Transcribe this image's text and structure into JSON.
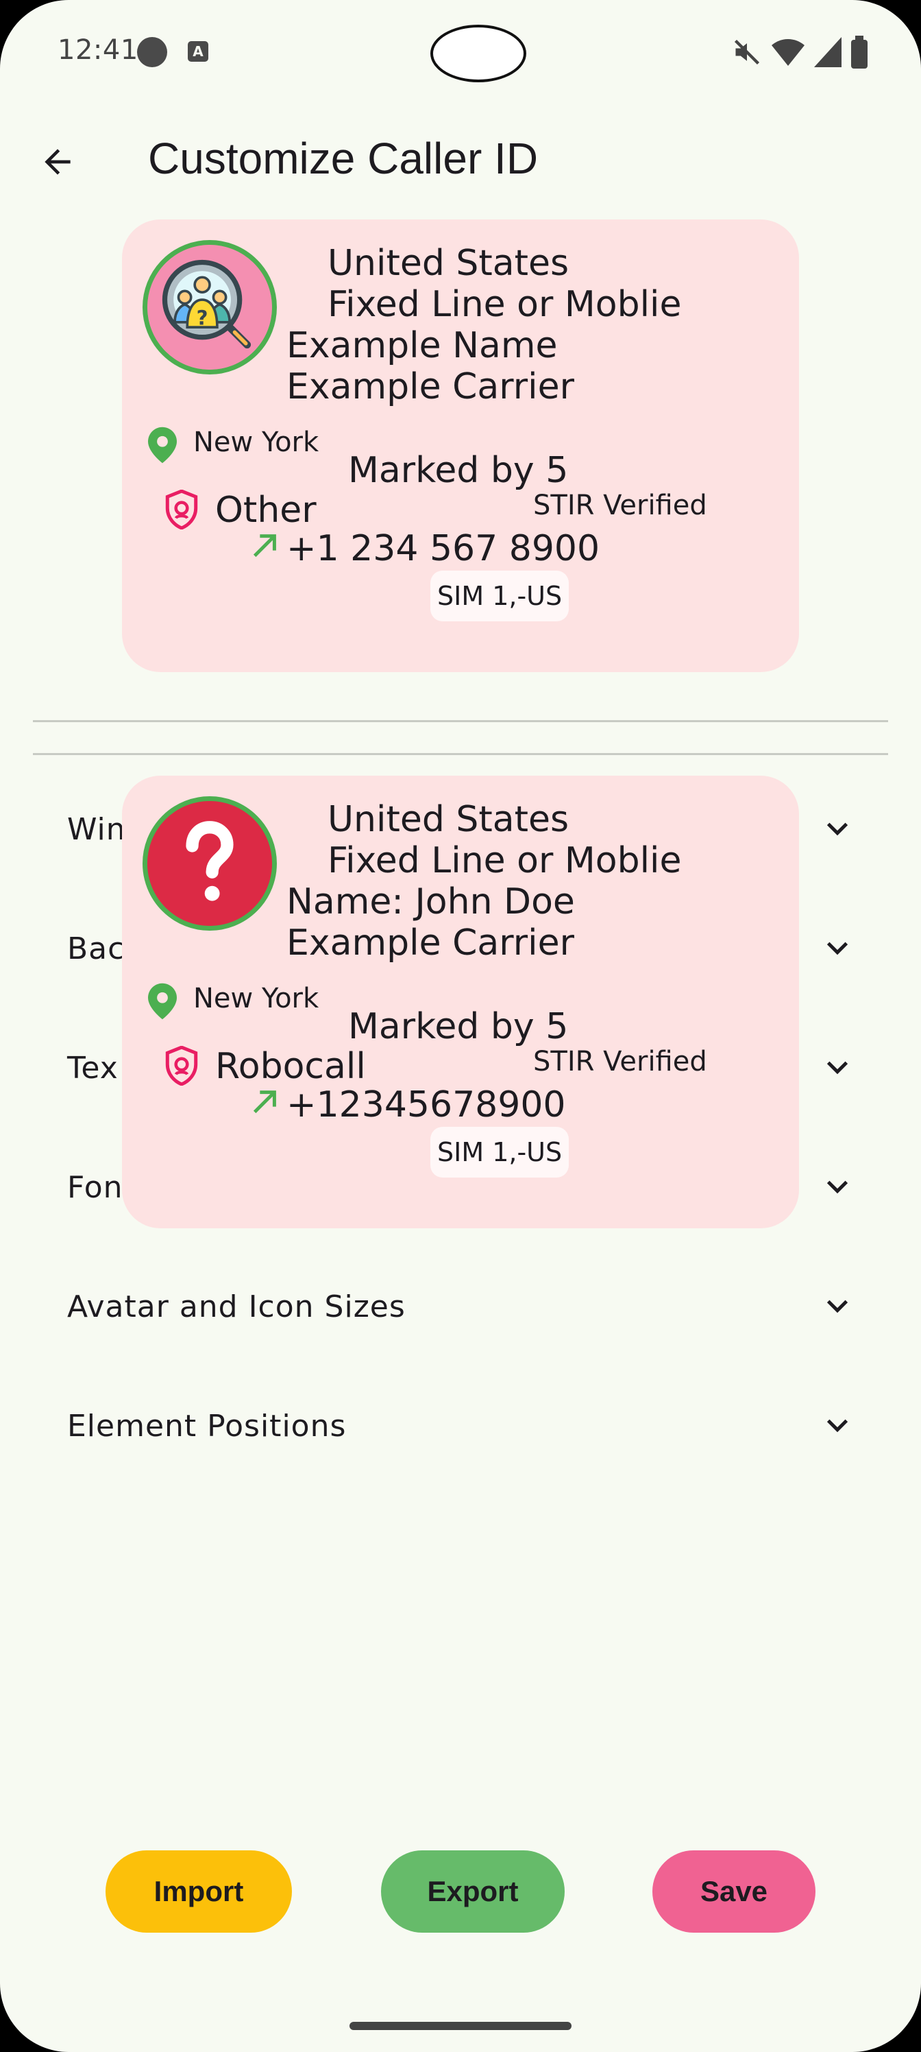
{
  "status_bar": {
    "time": "12:41",
    "app_glyph": "A"
  },
  "app_bar": {
    "title": "Customize Caller ID"
  },
  "preview_card": {
    "country": "United States",
    "line_type": "Fixed Line or Moblie",
    "name": "Example Name",
    "carrier": "Example Carrier",
    "location": "New York",
    "marked_by": "Marked by 5",
    "category": "Other",
    "stir": "STIR Verified",
    "number": "+1 234 567 8900",
    "sim": "SIM 1,-US",
    "background_color": "#fde2e2"
  },
  "overlay_card": {
    "country": "United States",
    "line_type": "Fixed Line or Moblie",
    "name": "Name: John Doe",
    "carrier": "Example Carrier",
    "location": "New York",
    "marked_by": "Marked by 5",
    "category": "Robocall",
    "stir": "STIR Verified",
    "number": "+12345678900",
    "sim": "SIM 1,-US",
    "background_color": "#fde2e2"
  },
  "settings_rows": [
    {
      "label": "Win"
    },
    {
      "label": "Bac"
    },
    {
      "label": "Tex"
    },
    {
      "label": "Fon"
    },
    {
      "label": "Avatar and Icon Sizes"
    },
    {
      "label": "Element Positions"
    }
  ],
  "buttons": {
    "import_label": "Import",
    "export_label": "Export",
    "save_label": "Save"
  },
  "colors": {
    "background": "#f7faf2",
    "card": "#fde2e2",
    "import": "#fcc00a",
    "export": "#66bb6a",
    "save": "#f06292",
    "accent_green": "#4caf50",
    "shield_pink": "#e91e63"
  },
  "icons": [
    "back-arrow-icon",
    "location-pin-icon",
    "shield-icon",
    "outgoing-call-arrow-icon",
    "chevron-down-icon",
    "question-mark-icon",
    "caller-search-icon"
  ]
}
